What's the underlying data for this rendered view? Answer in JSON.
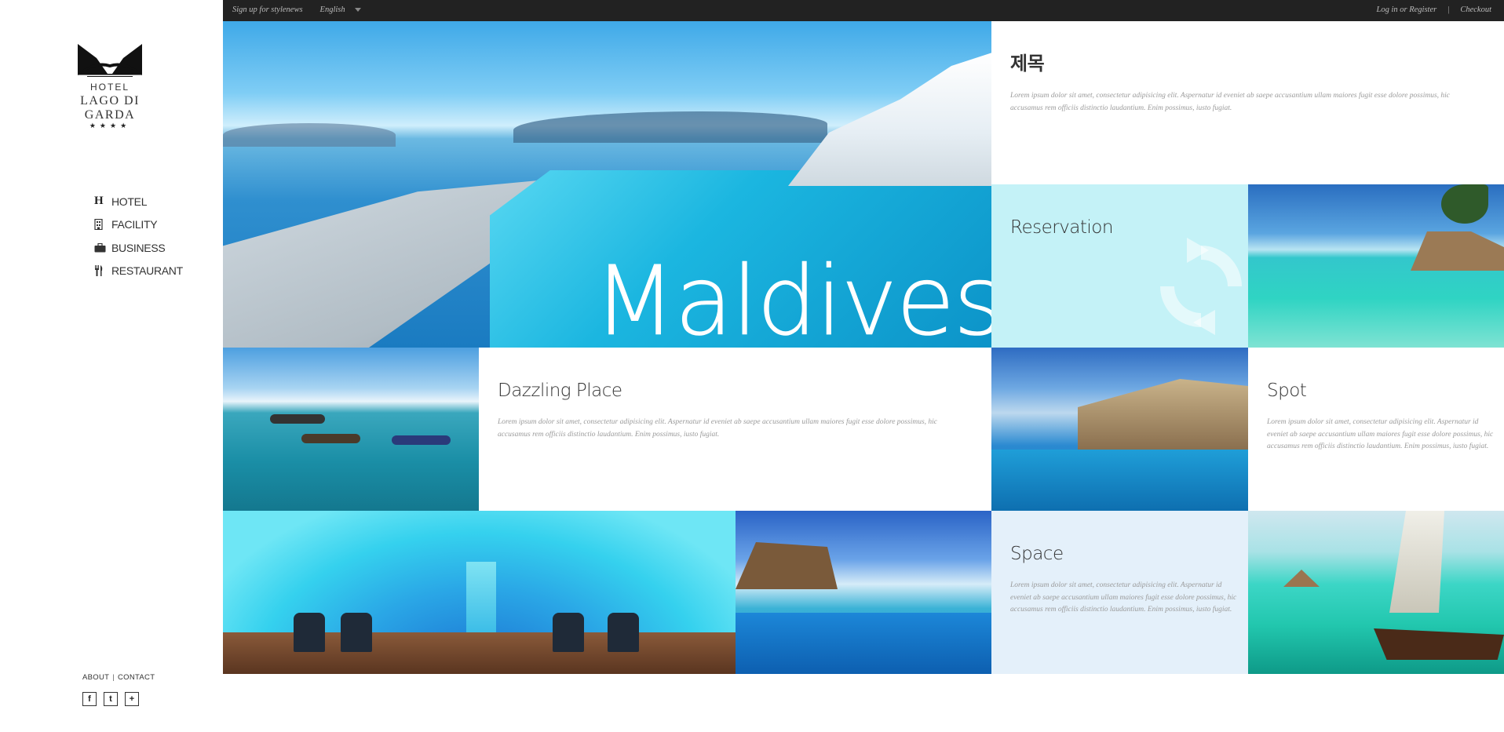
{
  "sidebar": {
    "logo": {
      "hotel": "HOTEL",
      "name": "LAGO DI GARDA",
      "stars": "★★★★"
    },
    "nav": [
      {
        "label": "HOTEL",
        "icon": "h-icon"
      },
      {
        "label": "FACILITY",
        "icon": "building-icon"
      },
      {
        "label": "BUSINESS",
        "icon": "briefcase-icon"
      },
      {
        "label": "RESTAURANT",
        "icon": "fork-knife-icon"
      }
    ],
    "footer": {
      "about": "ABOUT",
      "separator": "|",
      "contact": "CONTACT"
    },
    "social": [
      {
        "label": "f",
        "icon": "facebook-icon"
      },
      {
        "label": "t",
        "icon": "twitter-icon"
      },
      {
        "label": "+",
        "icon": "plus-icon"
      }
    ]
  },
  "topbar": {
    "newsletter": "Sign up for stylenews",
    "language": "English",
    "login": "Log in or Register",
    "separator": "|",
    "checkout": "Checkout"
  },
  "hero": {
    "brand": "Maldives"
  },
  "info": {
    "title": "제목",
    "text": "Lorem ipsum dolor sit amet, consectetur adipisicing elit. Aspernatur id eveniet ab saepe accusantium ullam maiores fugit esse dolore possimus, hic accusamus rem officiis distinctio laudantium. Enim possimus, iusto fugiat."
  },
  "reservation": {
    "title": "Reservation",
    "icon": "sync-icon"
  },
  "dazzling": {
    "title": "Dazzling Place",
    "text": "Lorem ipsum dolor sit amet, consectetur adipisicing elit. Aspernatur id eveniet ab saepe accusantium ullam maiores fugit esse dolore possimus, hic accusamus rem officiis distinctio laudantium. Enim possimus, iusto fugiat."
  },
  "spot": {
    "title": "Spot",
    "text": "Lorem ipsum dolor sit amet, consectetur adipisicing elit. Aspernatur id eveniet ab saepe accusantium ullam maiores fugit esse dolore possimus, hic accusamus rem officiis distinctio laudantium. Enim possimus, iusto fugiat."
  },
  "space": {
    "title": "Space",
    "text": "Lorem ipsum dolor sit amet, consectetur adipisicing elit. Aspernatur id eveniet ab saepe accusantium ullam maiores fugit esse dolore possimus, hic accusamus rem officiis distinctio laudantium. Enim possimus, iusto fugiat."
  },
  "colors": {
    "topbar": "#222222",
    "reservation_bg": "#c4f2f7",
    "space_bg": "#e4f0fa"
  }
}
